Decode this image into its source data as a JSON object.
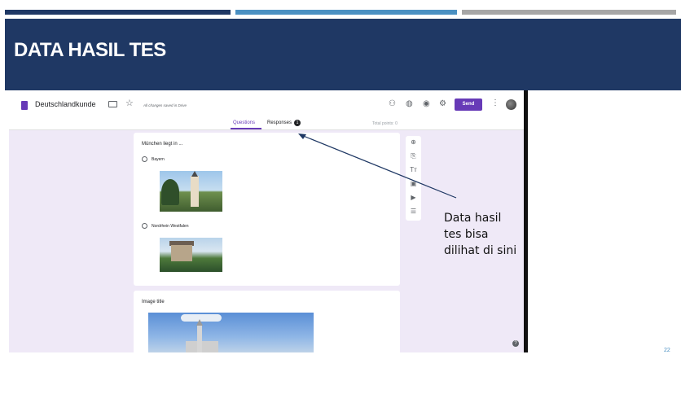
{
  "slide": {
    "title": "DATA HASIL TES",
    "annotation_lines": [
      "Data hasil",
      "tes bisa",
      "dilihat di sini"
    ],
    "slide_number": "22",
    "colors": {
      "navy": "#1f3864",
      "blue": "#4a90c2",
      "gray": "#a6a6a6"
    }
  },
  "form": {
    "doc_title": "Deutschlandkunde",
    "saved_status": "All changes saved in Drive",
    "send_label": "Send",
    "accent_color": "#673ab7",
    "tabs": {
      "questions": "Questions",
      "responses": "Responses",
      "responses_count": "1"
    },
    "total_points": "Total points: 0",
    "question": {
      "title": "München liegt in ...",
      "options": [
        "Bayern",
        "Nordrhein Westfalen"
      ]
    },
    "image_card_title": "Image title",
    "toolbar_icons": [
      "add-question-icon",
      "import-questions-icon",
      "add-title-icon",
      "add-image-icon",
      "add-video-icon",
      "add-section-icon"
    ],
    "topbar_icons": [
      "palette-icon",
      "customize-theme-icon",
      "preview-icon",
      "settings-icon"
    ]
  }
}
